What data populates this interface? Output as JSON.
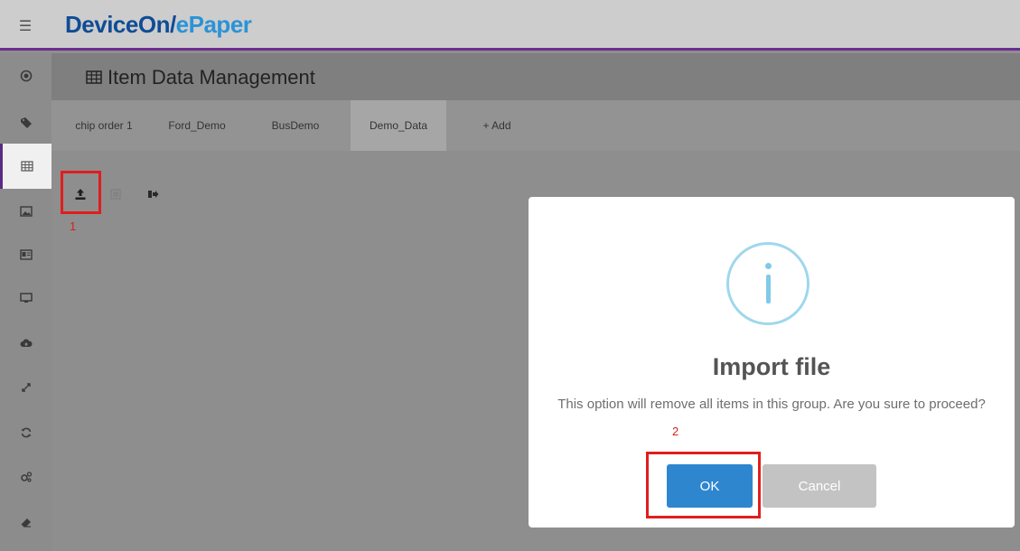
{
  "app": {
    "brand_part1": "DeviceOn/",
    "brand_part2": "ePaper",
    "menu_icon": "☰"
  },
  "page": {
    "title": "Item Data Management"
  },
  "sidebar": {
    "items": [
      {
        "icon": "globe-icon"
      },
      {
        "icon": "tag-icon"
      },
      {
        "icon": "table-icon",
        "active": true
      },
      {
        "icon": "image-icon"
      },
      {
        "icon": "id-card-icon"
      },
      {
        "icon": "monitor-icon"
      },
      {
        "icon": "cloud-upload-icon"
      },
      {
        "icon": "expand-icon"
      },
      {
        "icon": "refresh-icon"
      },
      {
        "icon": "cogs-icon"
      },
      {
        "icon": "eraser-icon"
      }
    ]
  },
  "tabs": [
    {
      "label": "chip order 1"
    },
    {
      "label": "Ford_Demo"
    },
    {
      "label": "BusDemo"
    },
    {
      "label": "Demo_Data",
      "active": true
    },
    {
      "label": "+ Add"
    }
  ],
  "toolbar": {
    "import_icon": "upload-icon",
    "list_icon": "list-icon",
    "export_icon": "sign-out-icon"
  },
  "annotations": {
    "step1": "1",
    "step2": "2"
  },
  "dialog": {
    "icon": "info-icon",
    "title": "Import file",
    "message": "This option will remove all items in this group. Are you sure to proceed?",
    "ok_label": "OK",
    "cancel_label": "Cancel"
  },
  "colors": {
    "brand_dark": "#0f4c96",
    "brand_light": "#2a93d6",
    "accent_purple": "#6b2d8f",
    "ok_button": "#2e86cf",
    "cancel_button": "#c3c3c3",
    "highlight_red": "#e11d1d"
  }
}
